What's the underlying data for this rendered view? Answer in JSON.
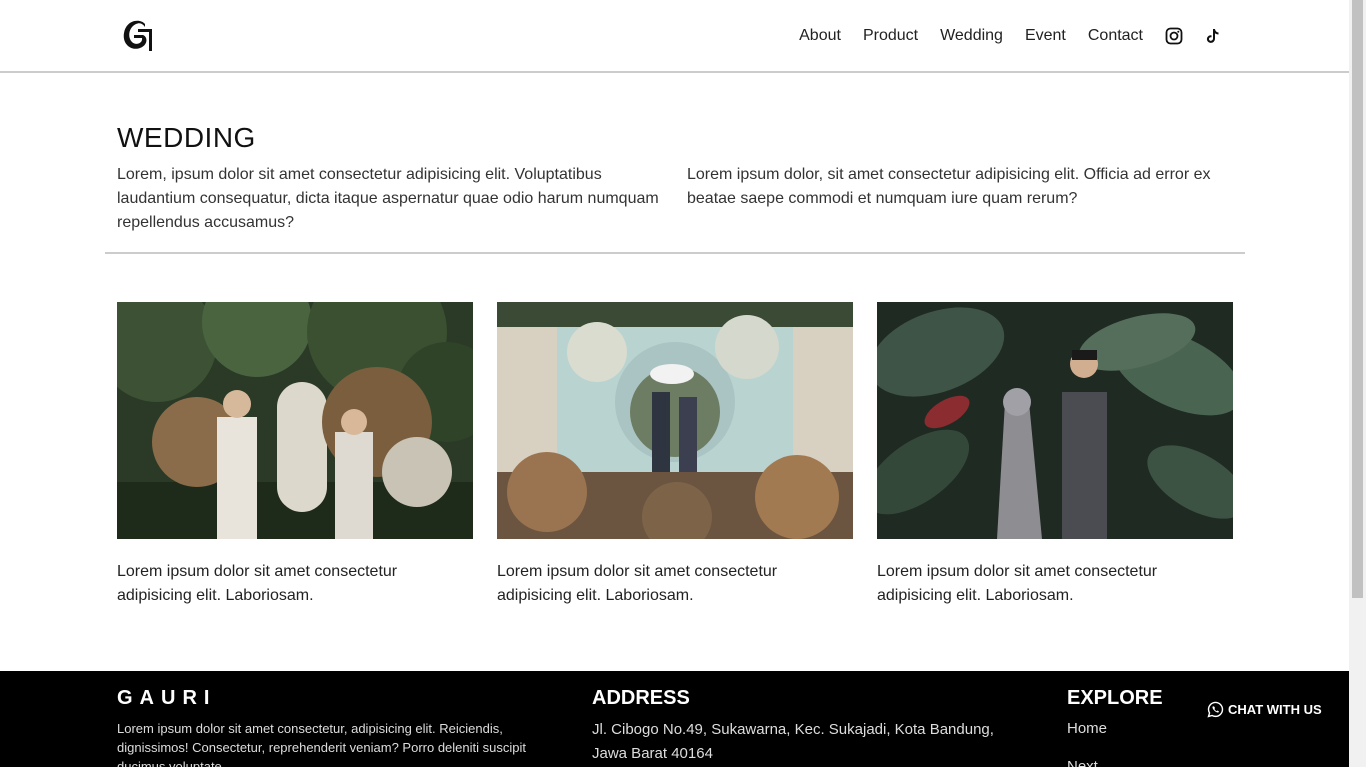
{
  "header": {
    "logo_alt": "G",
    "nav": [
      "About",
      "Product",
      "Wedding",
      "Event",
      "Contact"
    ],
    "icons": [
      "instagram-icon",
      "tiktok-icon"
    ]
  },
  "intro": {
    "title": "WEDDING",
    "left": "Lorem, ipsum dolor sit amet consectetur adipisicing elit. Voluptatibus laudantium consequatur, dicta itaque aspernatur quae odio harum numquam repellendus accusamus?",
    "right": "Lorem ipsum dolor, sit amet consectetur adipisicing elit. Officia ad error ex beatae saepe commodi et numquam iure quam rerum?"
  },
  "cards": [
    {
      "caption": "Lorem ipsum dolor sit amet consectetur adipisicing elit. Laboriosam."
    },
    {
      "caption": "Lorem ipsum dolor sit amet consectetur adipisicing elit. Laboriosam."
    },
    {
      "caption": "Lorem ipsum dolor sit amet consectetur adipisicing elit. Laboriosam."
    }
  ],
  "footer": {
    "brand": "GAURI",
    "description": "Lorem ipsum dolor sit amet consectetur, adipisicing elit. Reiciendis, dignissimos! Consectetur, reprehenderit veniam? Porro deleniti suscipit ducimus voluptate",
    "address_heading": "ADDRESS",
    "address": "Jl. Cibogo No.49, Sukawarna, Kec. Sukajadi, Kota Bandung, Jawa Barat 40164",
    "explore_heading": "EXPLORE",
    "explore_items": [
      "Home",
      "Next"
    ]
  },
  "chat": {
    "label": "CHAT WITH US"
  },
  "colors": {
    "footer_bg": "#000000",
    "divider": "#cccccc"
  }
}
